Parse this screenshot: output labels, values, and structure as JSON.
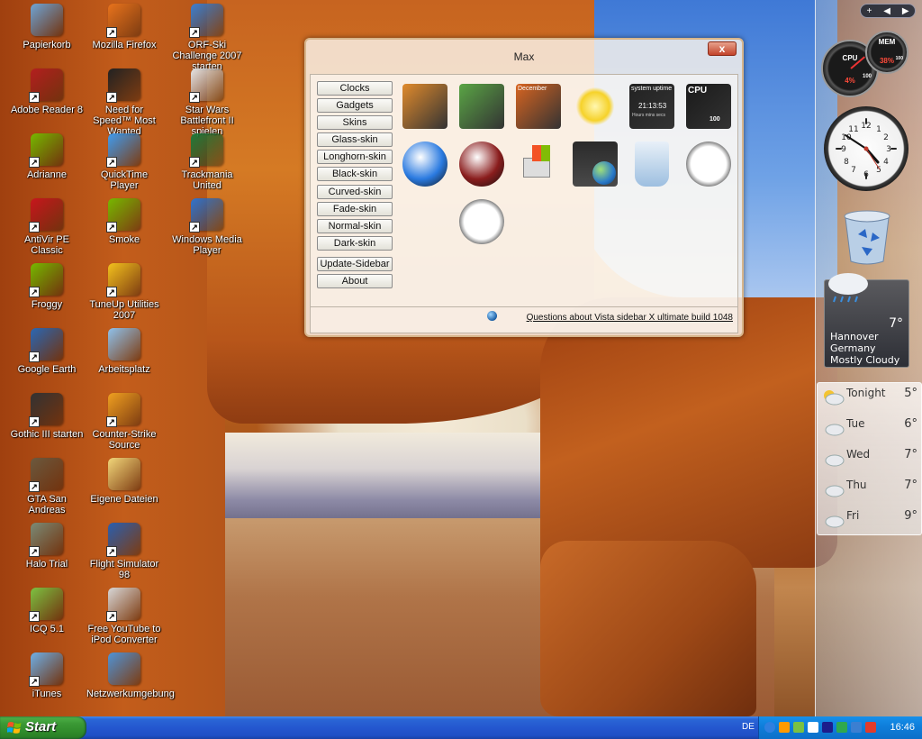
{
  "desktop": {
    "icons": [
      {
        "label": "Papierkorb",
        "color": "#6fa5d6",
        "shortcut": false
      },
      {
        "label": "Mozilla Firefox",
        "color": "#e8731c",
        "shortcut": true
      },
      {
        "label": "ORF-Ski Challenge 2007 starten",
        "color": "#3b7fd1",
        "shortcut": true
      },
      {
        "label": "Adobe Reader 8",
        "color": "#b41f1f",
        "shortcut": true
      },
      {
        "label": "Need for Speed™ Most Wanted",
        "color": "#222222",
        "shortcut": true
      },
      {
        "label": "Star Wars Battlefront II spielen",
        "color": "#e6e6e6",
        "shortcut": true
      },
      {
        "label": "Adrianne",
        "color": "#76b900",
        "shortcut": true
      },
      {
        "label": "QuickTime Player",
        "color": "#3f9cf0",
        "shortcut": true
      },
      {
        "label": "Trackmania United",
        "color": "#1f7a3a",
        "shortcut": true
      },
      {
        "label": "AntiVir PE Classic",
        "color": "#c8161d",
        "shortcut": true
      },
      {
        "label": "Smoke",
        "color": "#76b900",
        "shortcut": true
      },
      {
        "label": "Windows Media Player",
        "color": "#2f74d0",
        "shortcut": true
      },
      {
        "label": "Froggy",
        "color": "#76b900",
        "shortcut": true
      },
      {
        "label": "TuneUp Utilities 2007",
        "color": "#f3c21d",
        "shortcut": true
      },
      {
        "label": "Google Earth",
        "color": "#2a68b5",
        "shortcut": true
      },
      {
        "label": "Arbeitsplatz",
        "color": "#8fc2ec",
        "shortcut": false
      },
      {
        "label": "Gothic III starten",
        "color": "#333333",
        "shortcut": true
      },
      {
        "label": "Counter-Strike Source",
        "color": "#f0a020",
        "shortcut": true
      },
      {
        "label": "GTA San Andreas",
        "color": "#6b5a3f",
        "shortcut": true
      },
      {
        "label": "Eigene Dateien",
        "color": "#f2d77a",
        "shortcut": false
      },
      {
        "label": "Halo Trial",
        "color": "#7b8b76",
        "shortcut": true
      },
      {
        "label": "Flight Simulator 98",
        "color": "#2a5fb0",
        "shortcut": true
      },
      {
        "label": "ICQ 5.1",
        "color": "#7dc242",
        "shortcut": true
      },
      {
        "label": "Free YouTube to iPod Converter",
        "color": "#d8d8d8",
        "shortcut": true
      },
      {
        "label": "iTunes",
        "color": "#6fb0e6",
        "shortcut": true
      },
      {
        "label": "Netzwerkumgebung",
        "color": "#4f93d6",
        "shortcut": false
      }
    ]
  },
  "max_window": {
    "title": "Max",
    "close_label": "x",
    "buttons": [
      "Clocks",
      "Gadgets",
      "Skins",
      "Glass-skin",
      "Longhorn-skin",
      "Black-skin",
      "Curved-skin",
      "Fade-skin",
      "Normal-skin",
      "Dark-skin"
    ],
    "update_label": "Update-Sidebar",
    "about_label": "About",
    "gadgets": [
      {
        "icon": "news-feed-icon",
        "color": "#e08a2c"
      },
      {
        "icon": "photo-slideshow-icon",
        "color": "#5aa545"
      },
      {
        "icon": "calendar-icon",
        "color": "#d86420",
        "text": "December"
      },
      {
        "icon": "sun-weather-icon",
        "color": "#f6d22a"
      },
      {
        "icon": "system-uptime-icon",
        "color": "#222222",
        "text": "system uptime",
        "value": "21:13:53",
        "units": "Hours  mins  secs"
      },
      {
        "icon": "cpu-meter-icon",
        "color": "#1a1a1a",
        "text": "CPU",
        "value": "100"
      },
      {
        "icon": "media-player-icon",
        "color": "#2a7ae0"
      },
      {
        "icon": "search-magnifier-icon",
        "color": "#8a1d1d"
      },
      {
        "icon": "windows-computer-icon",
        "color": "#2a66c9"
      },
      {
        "icon": "network-globe-icon",
        "color": "#2f8a3a"
      },
      {
        "icon": "recycle-bin-icon",
        "color": "#9dbfe0"
      },
      {
        "icon": "search-icon",
        "color": "#5b8fc8"
      },
      {
        "icon": "signal-strength-icon",
        "color": "#3ea334"
      },
      {
        "icon": "analog-clock-icon",
        "color": "#c0392b"
      }
    ],
    "footer_link": "Questions about Vista sidebar X ultimate build 1048"
  },
  "sidebar": {
    "nav": [
      "+",
      "◀",
      "▶"
    ],
    "cpu_label": "CPU",
    "cpu_value": "4%",
    "cpu_max": "100",
    "mem_label": "MEM",
    "mem_value": "38%",
    "mem_max": "100",
    "weather": {
      "temp": "7°",
      "city": "Hannover",
      "country": "Germany",
      "condition": "Mostly Cloudy"
    },
    "forecast": [
      {
        "day": "Tonight",
        "temp": "5°"
      },
      {
        "day": "Tue",
        "temp": "6°"
      },
      {
        "day": "Wed",
        "temp": "7°"
      },
      {
        "day": "Thu",
        "temp": "7°"
      },
      {
        "day": "Fri",
        "temp": "9°"
      }
    ]
  },
  "taskbar": {
    "start_label": "Start",
    "language": "DE",
    "time": "16:46",
    "tray_colors": [
      "#2f7fe0",
      "#ff9a00",
      "#7ac142",
      "#ffffff",
      "#1c1c8c",
      "#2fa84f",
      "#3b7fd1",
      "#e23b2b"
    ]
  }
}
